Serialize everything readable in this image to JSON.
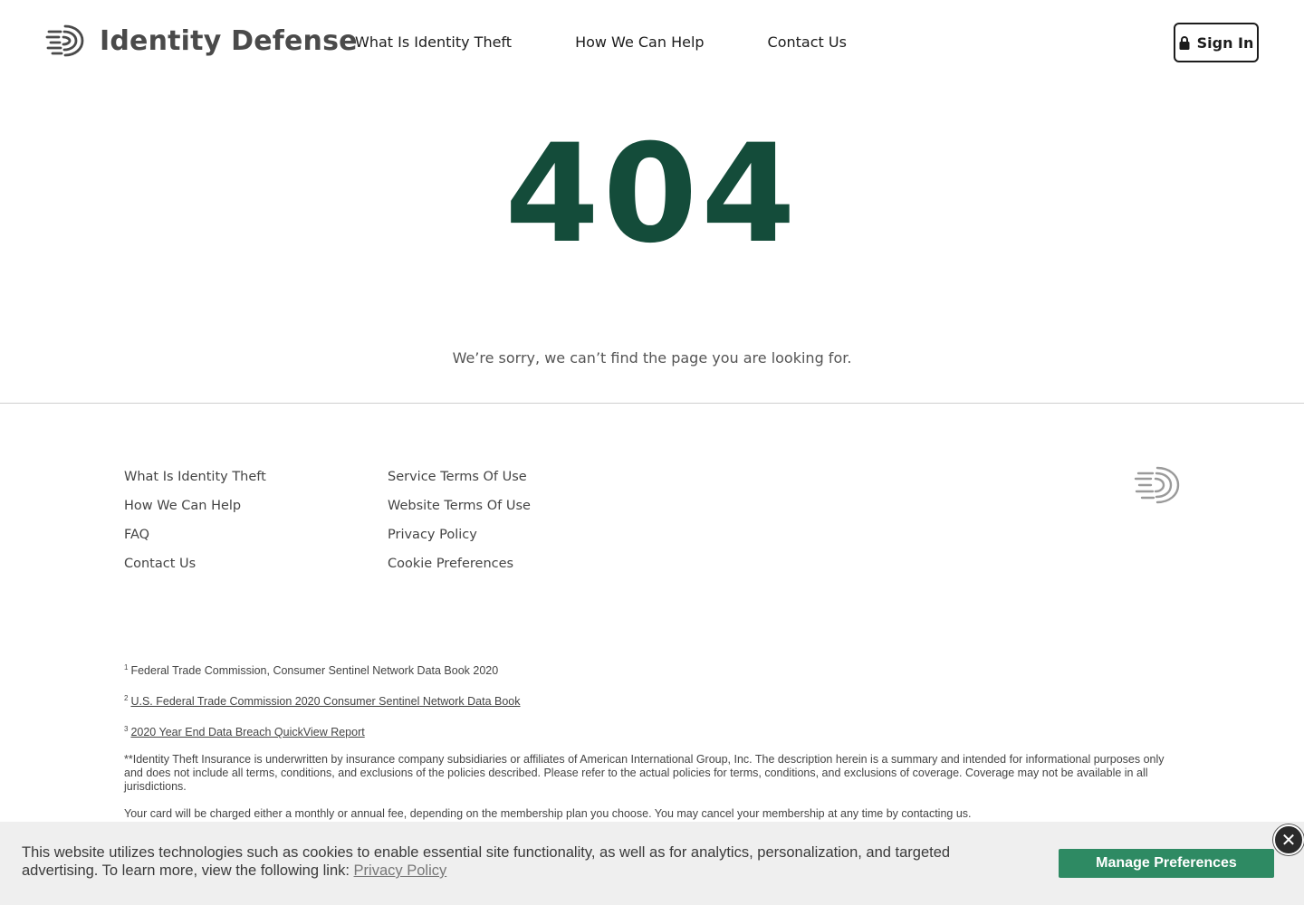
{
  "header": {
    "brand": "Identity Defense",
    "nav": [
      "What Is Identity Theft",
      "How We Can Help",
      "Contact Us"
    ],
    "signin_label": "Sign In"
  },
  "hero": {
    "code": "404",
    "message": "We’re sorry, we can’t find the page you are looking for."
  },
  "footer": {
    "col1": [
      "What Is Identity Theft",
      "How We Can Help",
      "FAQ",
      "Contact Us"
    ],
    "col2": [
      "Service Terms Of Use",
      "Website Terms Of Use",
      "Privacy Policy",
      "Cookie Preferences"
    ]
  },
  "notes": {
    "n1_sup": "1",
    "n1": "Federal Trade Commission, Consumer Sentinel Network Data Book 2020",
    "n2_sup": "2",
    "n2": "U.S. Federal Trade Commission 2020 Consumer Sentinel Network Data Book",
    "n3_sup": "3",
    "n3": "2020 Year End Data Breach QuickView Report",
    "n4": "**Identity Theft Insurance is underwritten by insurance company subsidiaries or affiliates of American International Group, Inc. The description herein is a summary and intended for informational purposes only and does not include all terms, conditions, and exclusions of the policies described. Please refer to the actual policies for terms, conditions, and exclusions of coverage. Coverage may not be available in all jurisdictions.",
    "n5": "Your card will be charged either a monthly or annual fee, depending on the membership plan you choose. You may cancel your membership at any time by contacting us."
  },
  "cookie": {
    "text": "This website utilizes technologies such as cookies to enable essential site functionality, as well as for analytics, personalization, and targeted advertising. To learn more, view the following link:",
    "link": "Privacy Policy",
    "button": "Manage Preferences",
    "close": "✕"
  },
  "colors": {
    "brand_green": "#144c3a",
    "button_green": "#2e8a63"
  }
}
